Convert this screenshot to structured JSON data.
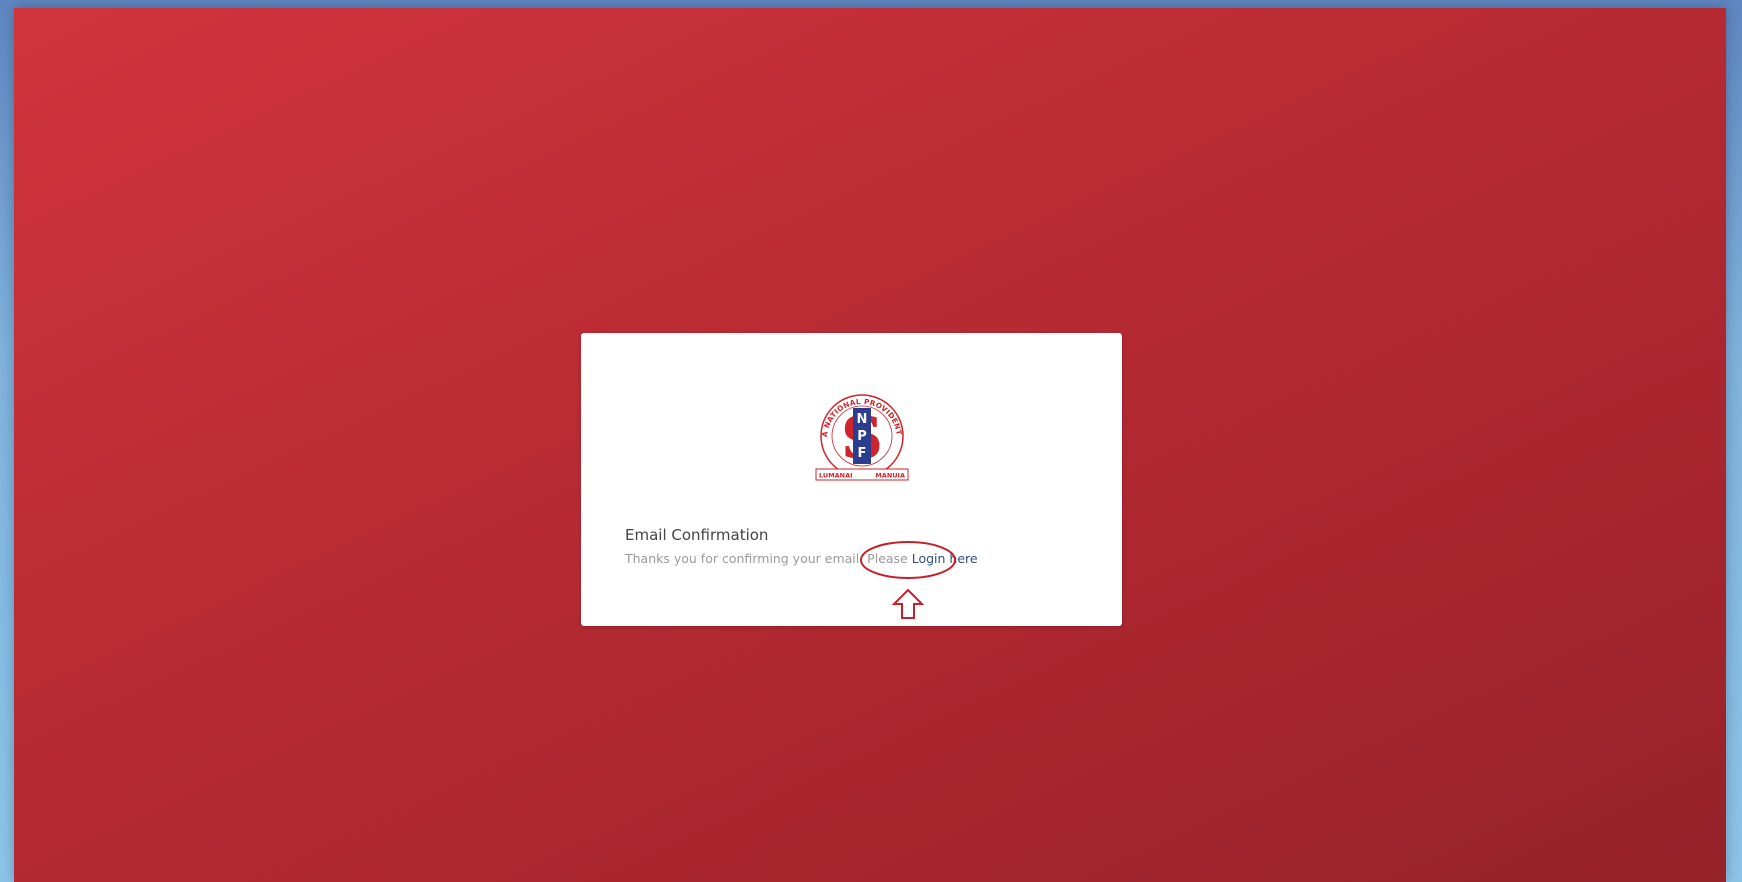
{
  "card": {
    "title": "Email Confirmation",
    "message_prefix": "Thanks you for confirming your email. Please ",
    "login_link": "Login here"
  },
  "logo": {
    "ring_text": "SAMOA NATIONAL PROVIDENT FUND",
    "letters": [
      "N",
      "P",
      "F"
    ],
    "banner_left": "LUMANAI",
    "banner_right": "MANUIA"
  },
  "colors": {
    "background_start": "#d1343d",
    "background_end": "#96222a",
    "card": "#ffffff",
    "annotation": "#c8212b",
    "logo_blue": "#2b3d8f",
    "logo_red": "#d1232a"
  },
  "annotations": {
    "highlight": "red-ellipse-icon",
    "pointer": "up-arrow-icon"
  }
}
